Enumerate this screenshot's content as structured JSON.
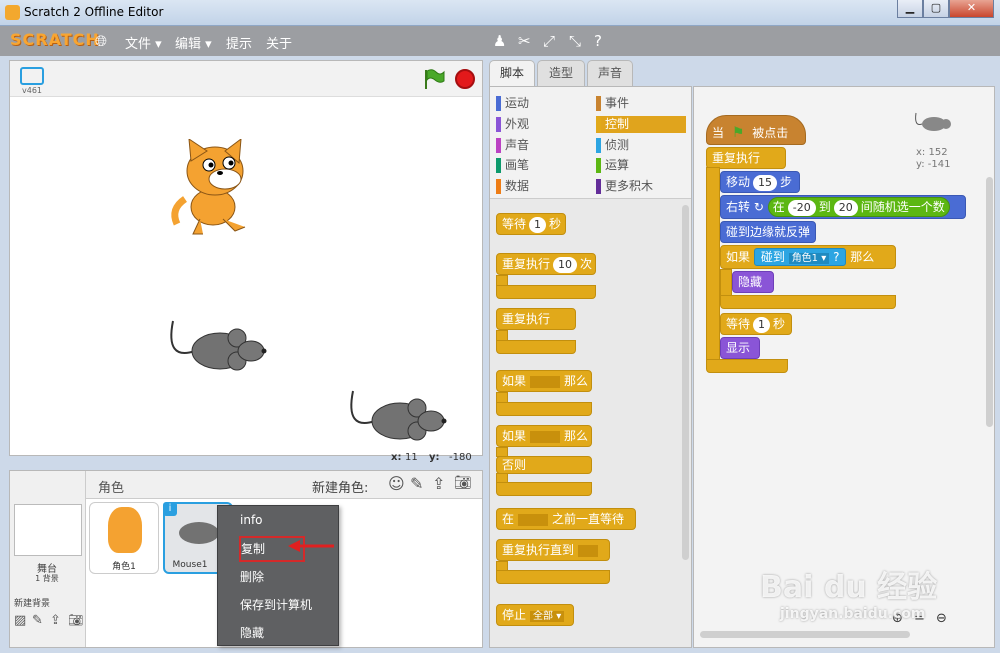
{
  "window": {
    "title": "Scratch 2 Offline Editor"
  },
  "menubar": {
    "logo": "SCRATCH",
    "items": [
      {
        "label": "文件 ▾"
      },
      {
        "label": "编辑 ▾"
      },
      {
        "label": "提示"
      },
      {
        "label": "关于"
      }
    ]
  },
  "stage": {
    "version": "v461",
    "coords": {
      "x_label": "x:",
      "x_value": "11",
      "y_label": "y:",
      "y_value": "-180"
    }
  },
  "sprites_pane": {
    "title": "角色",
    "new_sprite_label": "新建角色:",
    "stage_label": "舞台",
    "stage_backdrops": "1 背景",
    "new_backdrop_label": "新建背景",
    "sprites": [
      {
        "name": "角色1"
      },
      {
        "name": "Mouse1"
      }
    ]
  },
  "context_menu": {
    "items": [
      "info",
      "复制",
      "删除",
      "保存到计算机",
      "隐藏"
    ],
    "active_index": 1
  },
  "tabs": [
    "脚本",
    "造型",
    "声音"
  ],
  "categories": {
    "left": [
      {
        "label": "运动",
        "color": "#4a6cd4"
      },
      {
        "label": "外观",
        "color": "#8a55d7"
      },
      {
        "label": "声音",
        "color": "#bb42c3"
      },
      {
        "label": "画笔",
        "color": "#0e9a6c"
      },
      {
        "label": "数据",
        "color": "#ee7d16"
      }
    ],
    "right": [
      {
        "label": "事件",
        "color": "#c88330"
      },
      {
        "label": "控制",
        "color": "#e1a91a"
      },
      {
        "label": "侦测",
        "color": "#2ca5e2"
      },
      {
        "label": "运算",
        "color": "#5cb712"
      },
      {
        "label": "更多积木",
        "color": "#632d99"
      }
    ]
  },
  "palette_blocks": {
    "wait": {
      "text": "等待",
      "value": "1",
      "unit": "秒"
    },
    "repeat": {
      "text": "重复执行",
      "value": "10",
      "unit": "次"
    },
    "forever": {
      "text": "重复执行"
    },
    "if_then": {
      "text": "如果",
      "then": "那么"
    },
    "if_else": {
      "text": "如果",
      "then": "那么",
      "else": "否则"
    },
    "wait_until": {
      "text": "在",
      "suffix": "之前一直等待"
    },
    "repeat_until": {
      "text": "重复执行直到"
    },
    "stop": {
      "text": "停止",
      "option": "全部 ▾"
    }
  },
  "script": {
    "hat": {
      "text": "当",
      "suffix": "被点击"
    },
    "forever": "重复执行",
    "move": {
      "text": "移动",
      "value": "15",
      "unit": "步"
    },
    "turn": {
      "text": "右转",
      "in": "在",
      "from": "-20",
      "to_label": "到",
      "to": "20",
      "suffix": "间随机选一个数"
    },
    "bounce": "碰到边缘就反弹",
    "if": {
      "text": "如果",
      "sensing": "碰到",
      "target": "角色1 ▾",
      "q": "?",
      "then": "那么"
    },
    "hide": "隐藏",
    "wait": {
      "text": "等待",
      "value": "1",
      "unit": "秒"
    },
    "show": "显示",
    "sprite_info": {
      "x": "x: 152",
      "y": "y: -141"
    }
  },
  "watermark": {
    "brand": "Bai du 经验",
    "url": "jingyan.baidu.com"
  }
}
